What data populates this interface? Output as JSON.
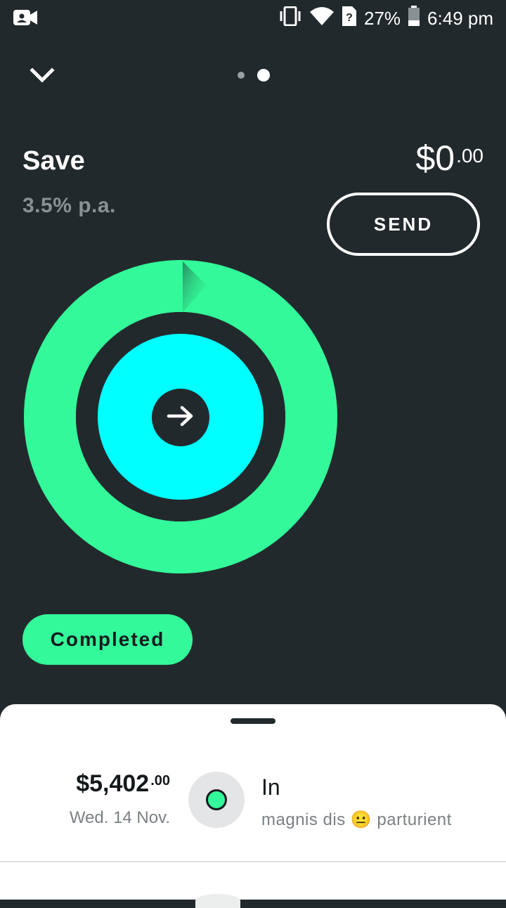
{
  "status_bar": {
    "battery_percent": "27%",
    "time": "6:49 pm",
    "icons": [
      "video-call-icon",
      "vibrate-icon",
      "wifi-icon",
      "sim-unknown-icon",
      "battery-icon"
    ]
  },
  "pager": {
    "total": 2,
    "active": 2
  },
  "account": {
    "title": "Save",
    "rate": "3.5% p.a.",
    "balance_main": "$0",
    "balance_cents": ".00",
    "send_label": "SEND"
  },
  "goal": {
    "status_label": "Completed",
    "colors": {
      "ring": "#33f99a",
      "core": "#00ffff",
      "background": "#22292c"
    }
  },
  "transactions": [
    {
      "amount_main": "$5,402",
      "amount_cents": ".00",
      "date": "Wed. 14 Nov.",
      "type": "In",
      "description": "magnis dis 😐 parturient"
    }
  ]
}
